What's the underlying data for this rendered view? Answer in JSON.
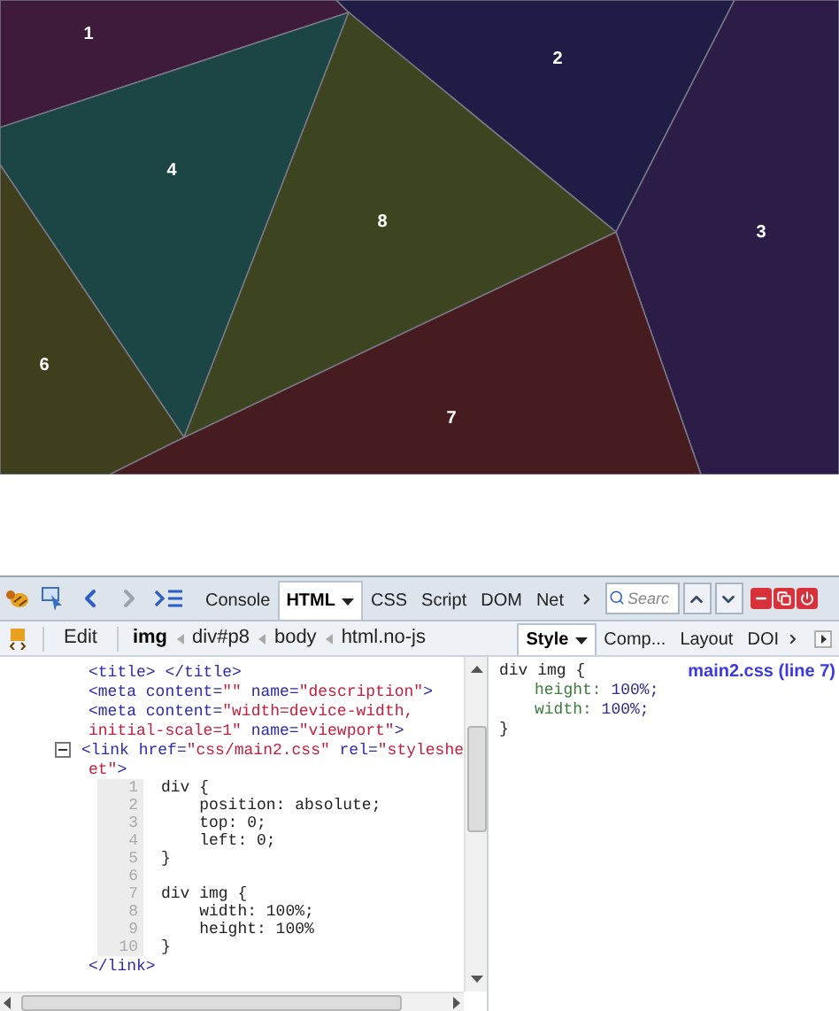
{
  "page": {
    "regions": [
      {
        "label": "1",
        "color": "#3f1b3b"
      },
      {
        "label": "2",
        "color": "#1f1c46"
      },
      {
        "label": "3",
        "color": "#2c1c48"
      },
      {
        "label": "4",
        "color": "#1c4545"
      },
      {
        "label": "6",
        "color": "#3f3f1e"
      },
      {
        "label": "7",
        "color": "#471c20"
      },
      {
        "label": "8",
        "color": "#3d4520"
      }
    ]
  },
  "devtools": {
    "panel_tabs": [
      {
        "label": "Console",
        "selected": false,
        "menu": false
      },
      {
        "label": "HTML",
        "selected": true,
        "menu": true
      },
      {
        "label": "CSS",
        "selected": false,
        "menu": false
      },
      {
        "label": "Script",
        "selected": false,
        "menu": false
      },
      {
        "label": "DOM",
        "selected": false,
        "menu": false
      },
      {
        "label": "Net",
        "selected": false,
        "menu": false
      }
    ],
    "search": {
      "placeholder": "Searc"
    },
    "edit_button": "Edit",
    "breadcrumbs": [
      {
        "label": "img",
        "selected": true
      },
      {
        "label": "div#p8",
        "selected": false
      },
      {
        "label": "body",
        "selected": false
      },
      {
        "label": "html.no-js",
        "selected": false
      }
    ],
    "side_tabs": [
      {
        "label": "Style",
        "selected": true,
        "menu": true
      },
      {
        "label": "Comp...",
        "selected": false,
        "menu": false
      },
      {
        "label": "Layout",
        "selected": false,
        "menu": false
      },
      {
        "label": "DOI",
        "selected": false,
        "menu": false
      }
    ],
    "html_lines": [
      {
        "kind": "markup",
        "tokens": [
          {
            "kind": "tag",
            "text": "<title> </title>"
          }
        ]
      },
      {
        "kind": "markup",
        "tokens": [
          {
            "kind": "tag",
            "text": "<meta content="
          },
          {
            "kind": "value",
            "text": "\"\""
          },
          {
            "kind": "tag",
            "text": " name="
          },
          {
            "kind": "value",
            "text": "\"description\""
          },
          {
            "kind": "tag",
            "text": ">"
          }
        ]
      },
      {
        "kind": "markup",
        "tokens": [
          {
            "kind": "tag",
            "text": "<meta content="
          },
          {
            "kind": "value",
            "text": "\"width=device-width,"
          }
        ]
      },
      {
        "kind": "markup",
        "tokens": [
          {
            "kind": "value",
            "text": "initial-scale=1\""
          },
          {
            "kind": "tag",
            "text": " name="
          },
          {
            "kind": "value",
            "text": "\"viewport\""
          },
          {
            "kind": "tag",
            "text": ">"
          }
        ]
      },
      {
        "kind": "markup",
        "expanded": true,
        "tokens": [
          {
            "kind": "tag",
            "text": "<link href="
          },
          {
            "kind": "value",
            "text": "\"css/main2.css\""
          },
          {
            "kind": "tag",
            "text": " rel="
          },
          {
            "kind": "value",
            "text": "\"styleshe"
          }
        ]
      },
      {
        "kind": "markup",
        "tokens": [
          {
            "kind": "value",
            "text": "et\""
          },
          {
            "kind": "tag",
            "text": ">"
          }
        ]
      },
      {
        "kind": "source",
        "lines": [
          {
            "number": "1",
            "text": "div {"
          },
          {
            "number": "2",
            "text": "    position: absolute;"
          },
          {
            "number": "3",
            "text": "    top: 0;"
          },
          {
            "number": "4",
            "text": "    left: 0;"
          },
          {
            "number": "5",
            "text": "}"
          },
          {
            "number": "6"
          },
          {
            "number": "7",
            "text": "div img {"
          },
          {
            "number": "8",
            "text": "    width: 100%;"
          },
          {
            "number": "9",
            "text": "    height: 100%"
          },
          {
            "number": "10",
            "text": "}"
          }
        ]
      },
      {
        "kind": "markup",
        "tokens": [
          {
            "kind": "tag",
            "text": "</link>"
          }
        ]
      }
    ],
    "style_rule": {
      "selector": "div img {",
      "source": "main2.css (line 7)",
      "properties": [
        {
          "name": "height:",
          "value": "100%;"
        },
        {
          "name": "width:",
          "value": "100%;"
        }
      ],
      "close": "}"
    }
  }
}
